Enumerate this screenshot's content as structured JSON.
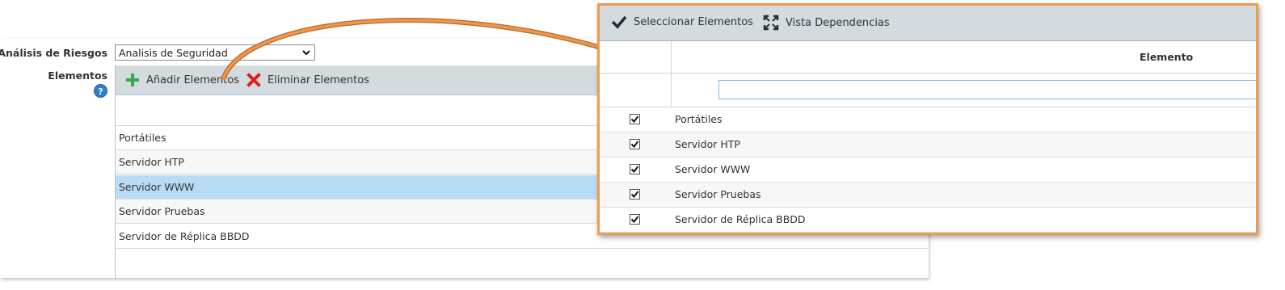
{
  "form": {
    "analisis_label": "Análisis de Riesgos",
    "analisis_value": "Analisis de Seguridad",
    "elementos_label": "Elementos"
  },
  "left_toolbar": {
    "add_label": "Añadir Elementos",
    "delete_label": "Eliminar Elementos"
  },
  "left_rows": [
    {
      "label": "Portátiles"
    },
    {
      "label": "Servidor HTP"
    },
    {
      "label": "Servidor WWW",
      "selected": true
    },
    {
      "label": "Servidor Pruebas"
    },
    {
      "label": "Servidor de Réplica BBDD"
    }
  ],
  "popup": {
    "select_label": "Seleccionar Elementos",
    "vista_label": "Vista Dependencias",
    "column_header": "Elemento",
    "filter_value": "",
    "rows": [
      {
        "label": "Portátiles",
        "checked": true
      },
      {
        "label": "Servidor HTP",
        "checked": true
      },
      {
        "label": "Servidor WWW",
        "checked": true
      },
      {
        "label": "Servidor Pruebas",
        "checked": true
      },
      {
        "label": "Servidor de Réplica BBDD",
        "checked": true
      }
    ]
  },
  "colors": {
    "toolbar_bg": "#d3dbdf",
    "selected_row": "#b9dcf6",
    "popup_border": "#ee9a4f",
    "add_icon": "#3aa845",
    "delete_icon": "#d9231f",
    "help_icon": "#2f7fd1"
  },
  "icons": {
    "add": "plus-icon",
    "delete": "x-icon",
    "help": "question-icon",
    "select": "checkmark-icon",
    "vista": "expand-icon",
    "dropdown": "chevron-down-icon"
  }
}
